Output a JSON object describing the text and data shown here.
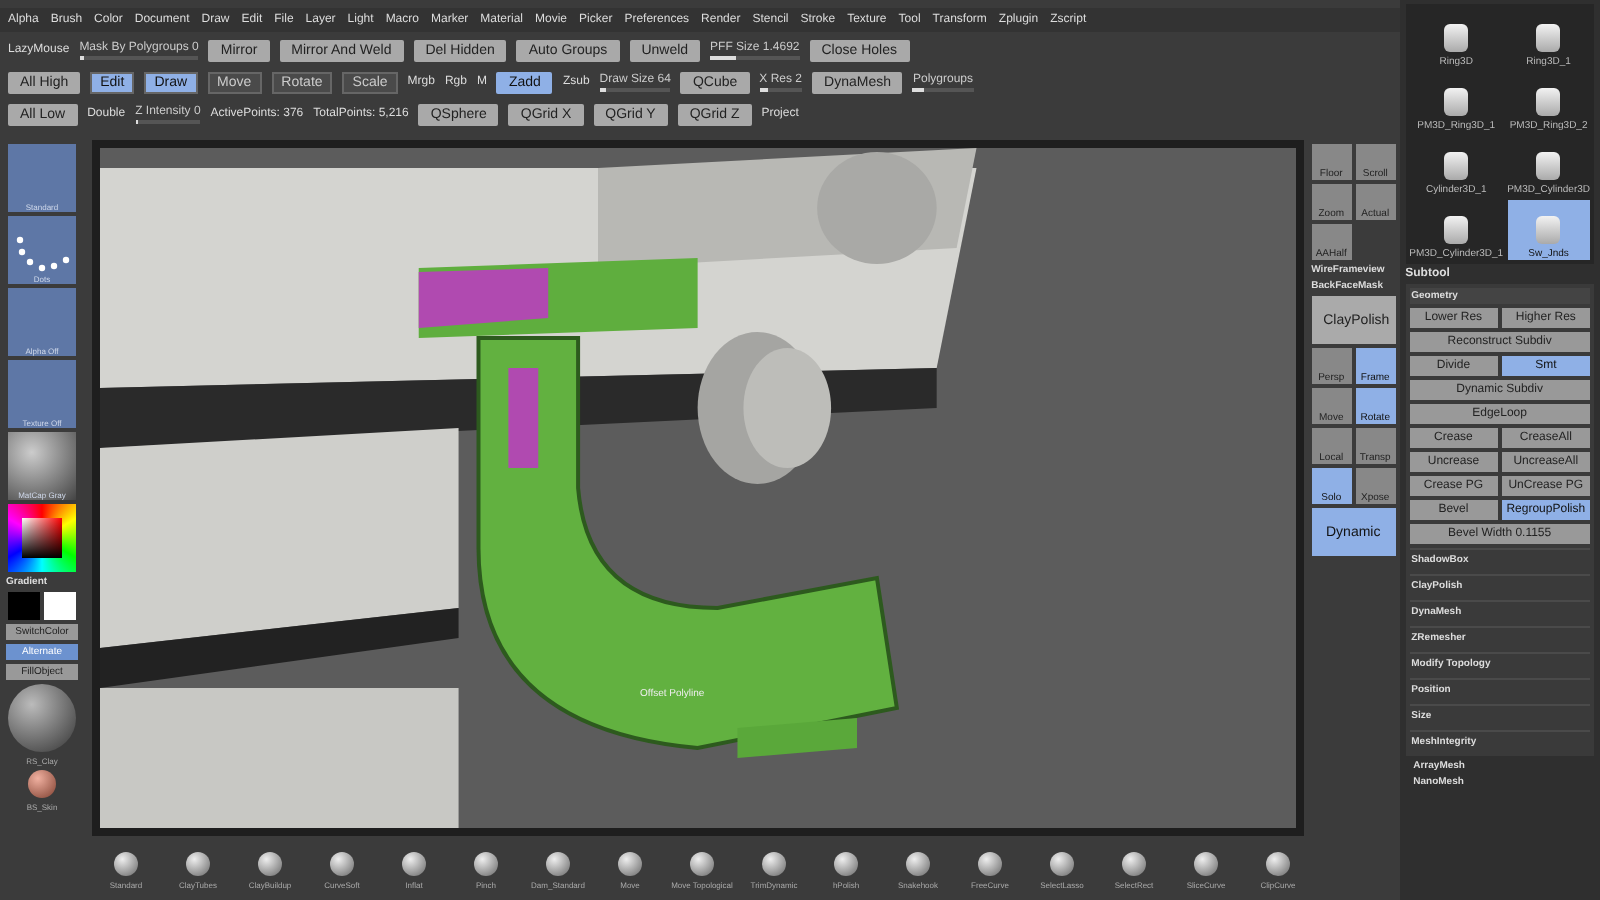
{
  "menu": [
    "Alpha",
    "Brush",
    "Color",
    "Document",
    "Draw",
    "Edit",
    "File",
    "Layer",
    "Light",
    "Macro",
    "Marker",
    "Material",
    "Movie",
    "Picker",
    "Preferences",
    "Render",
    "Stencil",
    "Stroke",
    "Texture",
    "Tool",
    "Transform",
    "Zplugin",
    "Zscript"
  ],
  "toolbar": {
    "top_row": [
      {
        "label": "LazyMouse",
        "kind": "text"
      },
      {
        "label": "Mask By Polygroups 0",
        "kind": "slider",
        "level": 0.0
      },
      {
        "label": "Mirror",
        "kind": "button",
        "selected": false
      },
      {
        "label": "Mirror And Weld",
        "kind": "button",
        "selected": false
      },
      {
        "label": "Del Hidden",
        "kind": "button",
        "selected": false
      },
      {
        "label": "Auto Groups",
        "kind": "button",
        "selected": false
      },
      {
        "label": "Unweld",
        "kind": "button",
        "selected": false
      },
      {
        "label": "PFF Size 1.4692",
        "kind": "slider",
        "level": 0.3
      },
      {
        "label": "Close Holes",
        "kind": "button",
        "selected": false
      }
    ],
    "middle_row": [
      {
        "label": "All High",
        "kind": "button",
        "selected": false
      },
      {
        "label": "Edit",
        "kind": "tool",
        "selected": true
      },
      {
        "label": "Draw",
        "kind": "tool",
        "selected": true
      },
      {
        "label": "Move",
        "kind": "tool",
        "selected": false
      },
      {
        "label": "Rotate",
        "kind": "tool",
        "selected": false
      },
      {
        "label": "Scale",
        "kind": "tool",
        "selected": false
      },
      {
        "label": "Mrgb",
        "kind": "text"
      },
      {
        "label": "Rgb",
        "kind": "text"
      },
      {
        "label": "M",
        "kind": "text"
      },
      {
        "label": "Zadd",
        "kind": "button",
        "selected": true
      },
      {
        "label": "Zsub",
        "kind": "text"
      },
      {
        "label": "Draw Size 64",
        "kind": "slider",
        "level": 0.1
      },
      {
        "label": "QCube",
        "kind": "button",
        "selected": false
      },
      {
        "label": "X Res 2",
        "kind": "slider",
        "level": 0.2
      },
      {
        "label": "DynaMesh",
        "kind": "button",
        "selected": false
      },
      {
        "label": "Polygroups",
        "kind": "slider",
        "level": 0.2
      }
    ],
    "bottom_row": [
      {
        "label": "All Low",
        "kind": "button",
        "selected": false
      },
      {
        "label": "Double",
        "kind": "text"
      },
      {
        "label": "Z Intensity 0",
        "kind": "slider",
        "level": 0.0
      },
      {
        "label": "ActivePoints: 376",
        "kind": "text"
      },
      {
        "label": "TotalPoints: 5,216",
        "kind": "text"
      },
      {
        "label": "QSphere",
        "kind": "button",
        "selected": false
      },
      {
        "label": "QGrid X",
        "kind": "button",
        "selected": false
      },
      {
        "label": "QGrid Y",
        "kind": "button",
        "selected": false
      },
      {
        "label": "QGrid Z",
        "kind": "button",
        "selected": false
      },
      {
        "label": "Project",
        "kind": "text"
      }
    ]
  },
  "left_shelf": [
    {
      "label": "Standard",
      "kind": "tile"
    },
    {
      "label": "Dots",
      "kind": "dots"
    },
    {
      "label": "Alpha Off",
      "kind": "tile"
    },
    {
      "label": "Texture Off",
      "kind": "tile"
    },
    {
      "label": "MatCap Gray",
      "kind": "material"
    },
    {
      "label": "Gradient",
      "kind": "picker"
    },
    {
      "label": "SwitchColor",
      "kind": "button"
    },
    {
      "label": "Alternate",
      "kind": "active"
    },
    {
      "label": "FillObject",
      "kind": "button"
    },
    {
      "label": "RS_Clay",
      "kind": "sphere"
    },
    {
      "label": "BS_Skin",
      "kind": "ball"
    }
  ],
  "viewport": {
    "label": "Offset Polyline"
  },
  "side_shelf": [
    {
      "label": "Floor",
      "selected": false
    },
    {
      "label": "Scroll",
      "selected": false
    },
    {
      "label": "Zoom",
      "selected": false
    },
    {
      "label": "Actual",
      "selected": false
    },
    {
      "label": "AAHalf",
      "selected": false
    },
    {
      "label": "WireFrameview",
      "kind": "text"
    },
    {
      "label": "BackFaceMask",
      "kind": "text"
    },
    {
      "label": "ClayPolish",
      "selected": false,
      "kind": "wide"
    },
    {
      "label": "Persp",
      "selected": false
    },
    {
      "label": "Frame",
      "selected": true
    },
    {
      "label": "Move",
      "selected": false
    },
    {
      "label": "Rotate",
      "selected": true
    },
    {
      "label": "Local",
      "selected": false
    },
    {
      "label": "Transp",
      "selected": false
    },
    {
      "label": "Solo",
      "selected": true
    },
    {
      "label": "Xpose",
      "selected": false
    },
    {
      "label": "Dynamic",
      "selected": true,
      "kind": "wide"
    }
  ],
  "brushes": [
    "Standard",
    "ClayTubes",
    "ClayBuildup",
    "CurveSoft",
    "Inflat",
    "Pinch",
    "Dam_Standard",
    "Move",
    "Move Topological",
    "TrimDynamic",
    "hPolish",
    "Snakehook",
    "FreeCurve",
    "SelectLasso",
    "SelectRect",
    "SliceCurve",
    "ClipCurve"
  ],
  "subtools": [
    {
      "label": "Ring3D",
      "selected": false
    },
    {
      "label": "Ring3D_1",
      "selected": false
    },
    {
      "label": "PM3D_Ring3D_1",
      "selected": false
    },
    {
      "label": "PM3D_Ring3D_2",
      "selected": false
    },
    {
      "label": "Cylinder3D_1",
      "selected": false
    },
    {
      "label": "PM3D_Cylinder3D",
      "selected": false
    },
    {
      "label": "PM3D_Cylinder3D_1",
      "selected": false
    },
    {
      "label": "Sw_Jnds",
      "selected": true
    }
  ],
  "panel": {
    "title": "Subtool",
    "section": "Geometry",
    "rows": [
      [
        {
          "label": "Lower Res",
          "selected": false
        },
        {
          "label": "Higher Res",
          "selected": false
        }
      ],
      [
        {
          "label": "Reconstruct Subdiv",
          "selected": false
        }
      ],
      [
        {
          "label": "Divide",
          "selected": false
        },
        {
          "label": "Smt",
          "selected": true
        }
      ],
      [
        {
          "label": "Dynamic Subdiv",
          "selected": false
        }
      ],
      [
        {
          "label": "EdgeLoop",
          "selected": false
        }
      ],
      [
        {
          "label": "Crease",
          "selected": false
        },
        {
          "label": "CreaseAll",
          "selected": false
        }
      ],
      [
        {
          "label": "Uncrease",
          "selected": false
        },
        {
          "label": "UncreaseAll",
          "selected": false
        }
      ],
      [
        {
          "label": "Crease PG",
          "selected": false
        },
        {
          "label": "UnCrease PG",
          "selected": false
        }
      ],
      [
        {
          "label": "Bevel",
          "selected": false
        },
        {
          "label": "RegroupPolish",
          "selected": true
        }
      ],
      [
        {
          "label": "Bevel Width 0.1155",
          "selected": false
        }
      ]
    ],
    "items": [
      "ShadowBox",
      "ClayPolish",
      "DynaMesh",
      "ZRemesher",
      "Modify Topology",
      "Position",
      "Size",
      "MeshIntegrity"
    ],
    "footer": [
      "ArrayMesh",
      "NanoMesh"
    ]
  }
}
